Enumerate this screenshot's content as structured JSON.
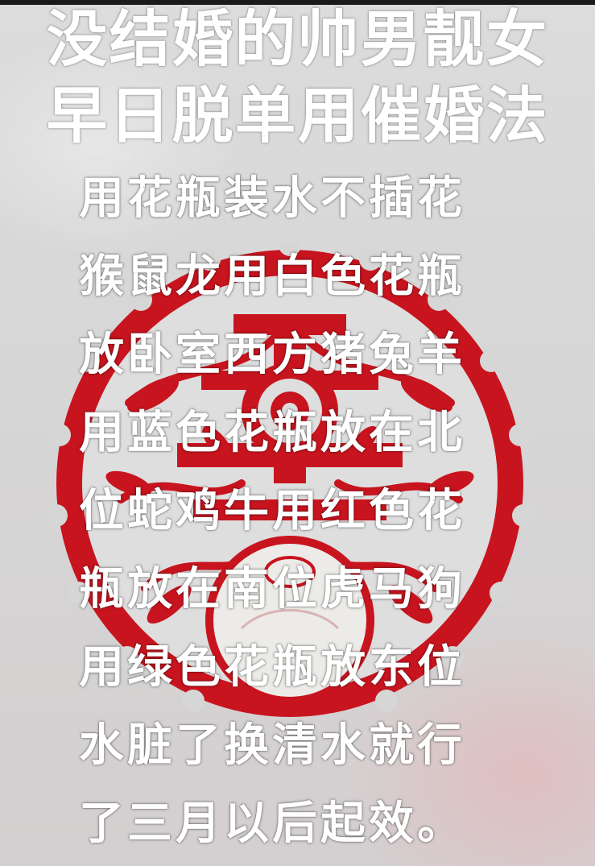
{
  "headline": {
    "line1": "没结婚的帅男靓女",
    "line2": "早日脱单用催婚法"
  },
  "body_lines": [
    "用花瓶装水不插花",
    "猴鼠龙用白色花瓶",
    "放卧室西方猪兔羊",
    "用蓝色花瓶放在北",
    "位蛇鸡牛用红色花",
    "瓶放在南位虎马狗",
    "用绿色花瓶放东位",
    "水脏了换清水就行",
    "了三月以后起效。"
  ],
  "colors": {
    "papercut_red": "#c8141e",
    "background": "#d8d8d8",
    "text": "#ffffff"
  }
}
